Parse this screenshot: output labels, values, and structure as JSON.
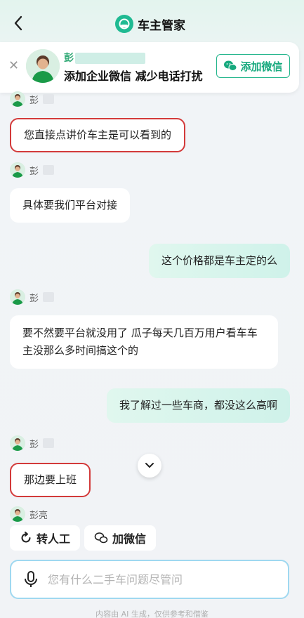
{
  "header": {
    "title": "车主管家",
    "back_icon": "chevron-left-icon",
    "brand_color": "#1fba92"
  },
  "promo": {
    "close_icon": "close-icon",
    "name": "彭",
    "text": "添加企业微信 减少电话打扰",
    "button_label": "添加微信",
    "button_icon": "wechat-icon"
  },
  "messages": [
    {
      "sender": "彭",
      "side": "in",
      "text": "您直接点讲价车主是可以看到的",
      "highlighted": true
    },
    {
      "sender": "彭",
      "side": "in",
      "text": "具体要我们平台对接"
    },
    {
      "side": "out",
      "text": "这个价格都是车主定的么"
    },
    {
      "sender": "彭",
      "side": "in",
      "text": "要不然要平台就没用了 瓜子每天几百万用户看车车主没那么多时间搞这个的"
    },
    {
      "side": "out",
      "text": "我了解过一些车商，都没这么高啊"
    },
    {
      "sender": "彭",
      "side": "in",
      "text": "那边要上班",
      "highlighted": true
    },
    {
      "sender": "彭亮",
      "side": "in"
    }
  ],
  "quick_actions": [
    {
      "label": "转人工",
      "icon": "refresh-icon"
    },
    {
      "label": "加微信",
      "icon": "wechat-icon"
    }
  ],
  "input": {
    "placeholder": "您有什么二手车问题尽管问",
    "icon": "microphone-icon"
  },
  "disclaimer": "内容由 AI 生成，仅供参考和借鉴"
}
